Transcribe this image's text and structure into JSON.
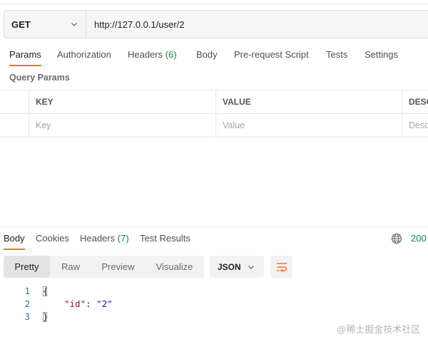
{
  "request": {
    "method": "GET",
    "url": "http://127.0.0.1/user/2"
  },
  "request_tabs": [
    {
      "label": "Params",
      "active": true
    },
    {
      "label": "Authorization"
    },
    {
      "label": "Headers",
      "count": "(6)"
    },
    {
      "label": "Body"
    },
    {
      "label": "Pre-request Script"
    },
    {
      "label": "Tests"
    },
    {
      "label": "Settings"
    }
  ],
  "query_params": {
    "title": "Query Params",
    "headers": [
      "KEY",
      "VALUE",
      "DESC"
    ],
    "placeholders": [
      "Key",
      "Value",
      "Desc"
    ]
  },
  "response_tabs": [
    {
      "label": "Body",
      "active": true
    },
    {
      "label": "Cookies"
    },
    {
      "label": "Headers",
      "count": "(7)"
    },
    {
      "label": "Test Results"
    }
  ],
  "response_status": "200",
  "view_modes": [
    "Pretty",
    "Raw",
    "Preview",
    "Visualize"
  ],
  "format": "JSON",
  "code_lines": [
    {
      "num": "1",
      "text": "{"
    },
    {
      "num": "2",
      "key": "\"id\"",
      "sep": ": ",
      "value": "\"2\""
    },
    {
      "num": "3",
      "text": "}"
    }
  ],
  "watermark": "@稀土掘金技术社区",
  "colors": {
    "accent": "#ff6c37",
    "success": "#0a8a3f",
    "line_number": "#2a6fbe"
  }
}
